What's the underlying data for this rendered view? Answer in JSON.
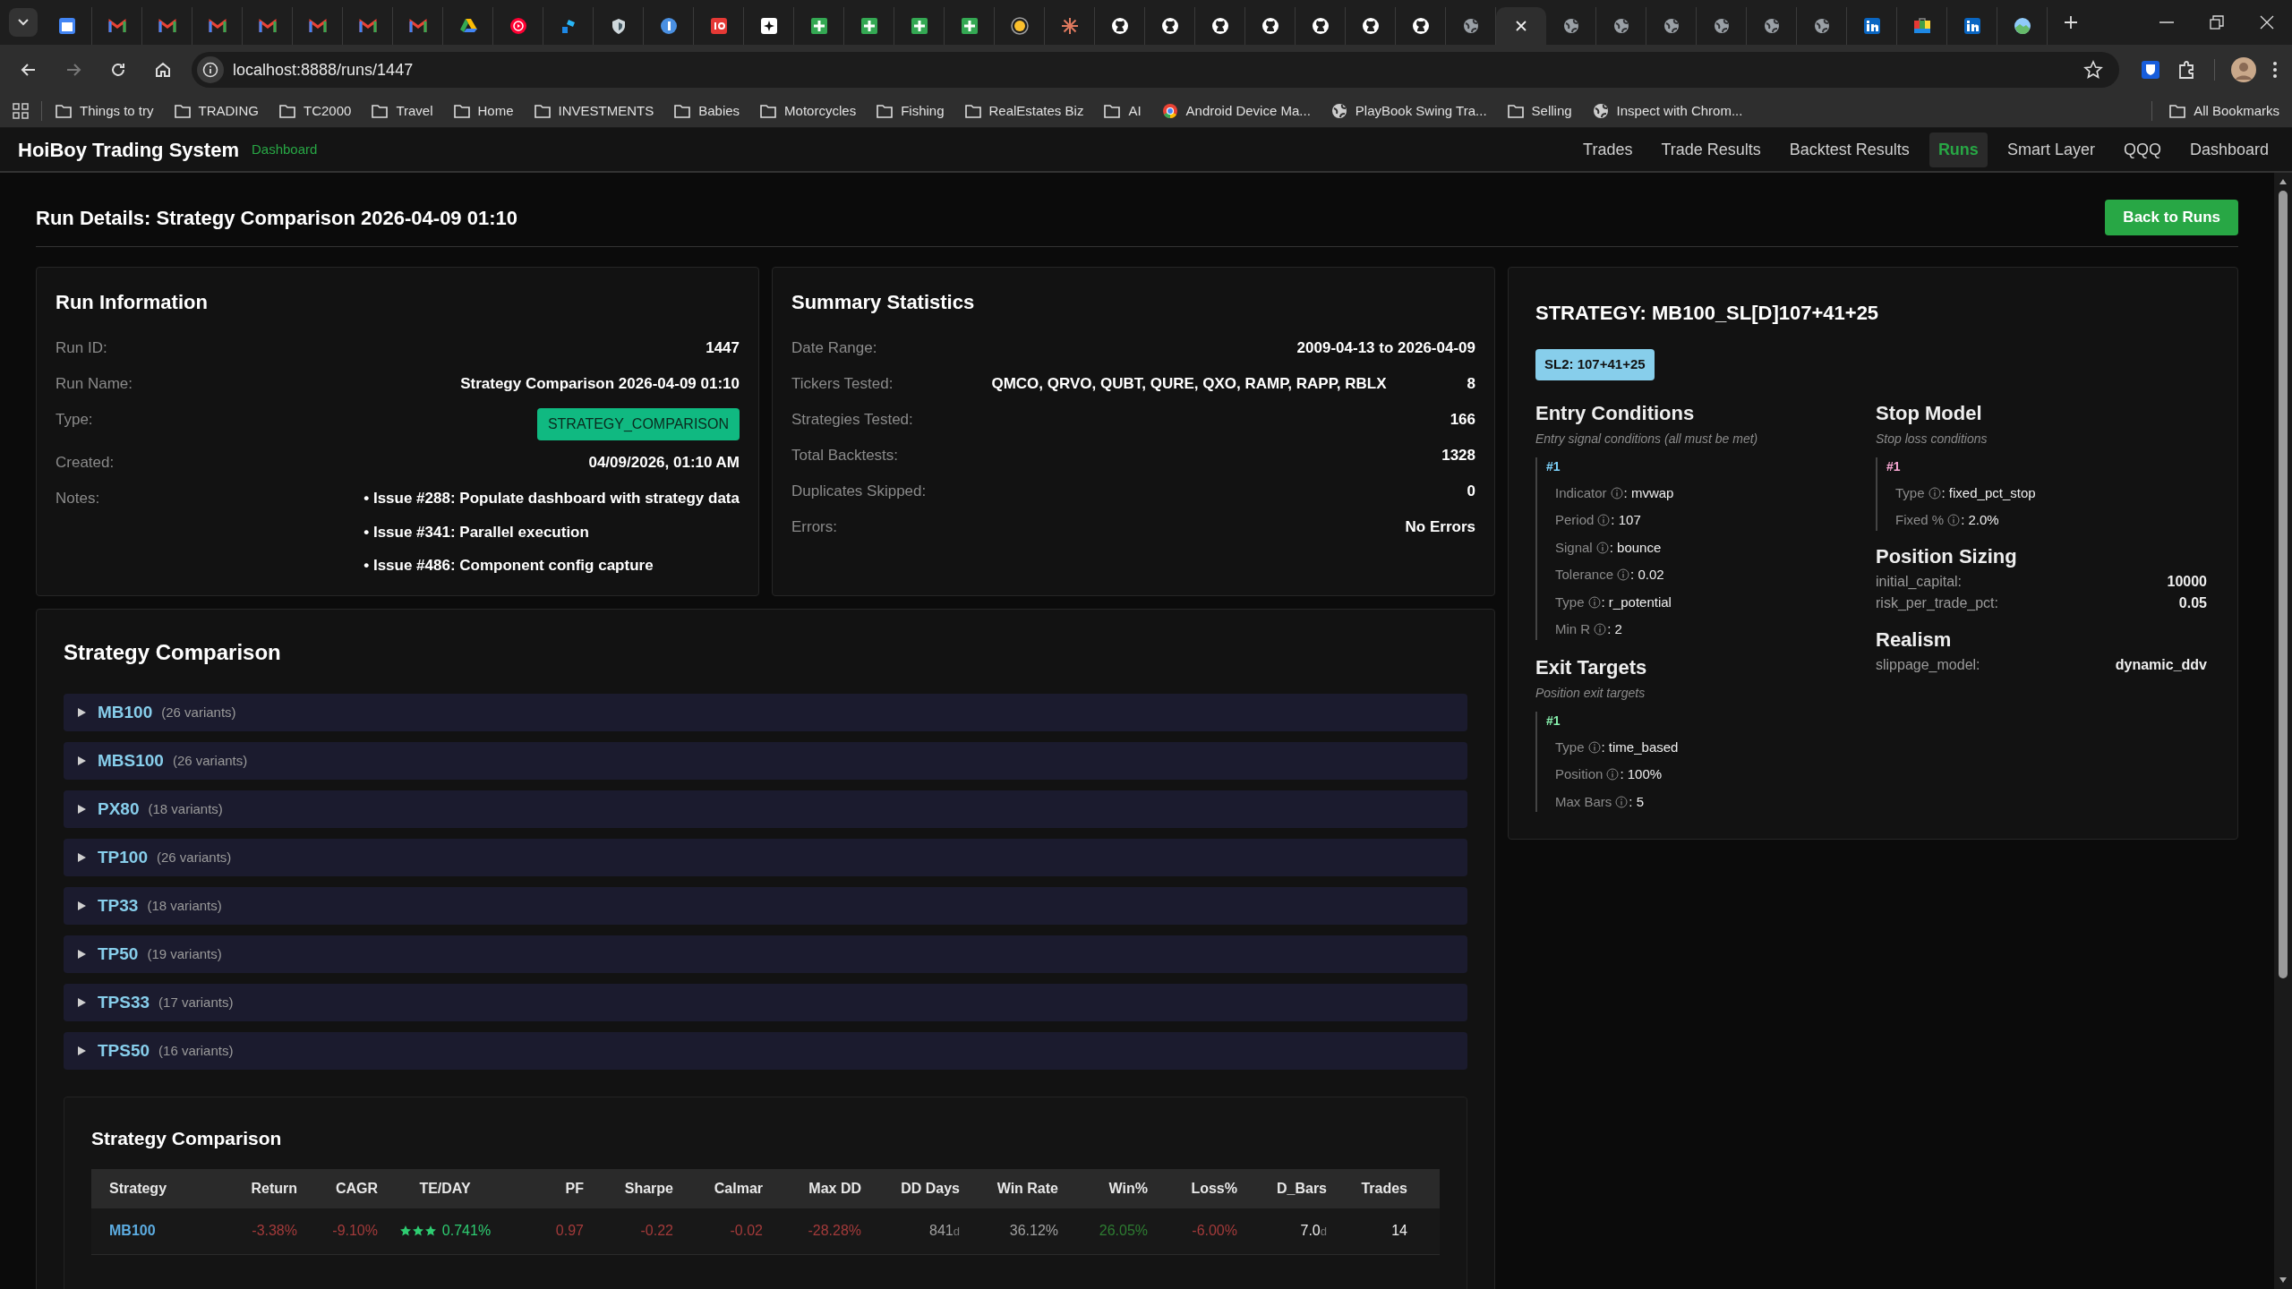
{
  "browser": {
    "tabs": [
      {
        "kind": "calendar",
        "selected": false
      },
      {
        "kind": "mail",
        "selected": false
      },
      {
        "kind": "mail",
        "selected": false
      },
      {
        "kind": "mail",
        "selected": false
      },
      {
        "kind": "mail",
        "selected": false
      },
      {
        "kind": "mail",
        "selected": false
      },
      {
        "kind": "mail",
        "selected": false
      },
      {
        "kind": "mail",
        "selected": false
      },
      {
        "kind": "drive",
        "selected": false
      },
      {
        "kind": "play",
        "selected": false
      },
      {
        "kind": "app",
        "selected": false
      },
      {
        "kind": "shield",
        "selected": false
      },
      {
        "kind": "disc",
        "selected": false
      },
      {
        "kind": "tile",
        "selected": false
      },
      {
        "kind": "sparkle",
        "selected": false
      },
      {
        "kind": "sheet",
        "selected": false
      },
      {
        "kind": "sheet",
        "selected": false
      },
      {
        "kind": "sheet",
        "selected": false
      },
      {
        "kind": "sheet",
        "selected": false
      },
      {
        "kind": "bulb",
        "selected": false
      },
      {
        "kind": "burst",
        "selected": false
      },
      {
        "kind": "octo",
        "selected": false
      },
      {
        "kind": "octo",
        "selected": false
      },
      {
        "kind": "octo",
        "selected": false
      },
      {
        "kind": "octo",
        "selected": false
      },
      {
        "kind": "octo",
        "selected": false
      },
      {
        "kind": "octo",
        "selected": false
      },
      {
        "kind": "octo",
        "selected": false
      },
      {
        "kind": "globe",
        "selected": false
      },
      {
        "kind": "close",
        "selected": true
      },
      {
        "kind": "globe",
        "selected": false
      },
      {
        "kind": "globe",
        "selected": false
      },
      {
        "kind": "globe",
        "selected": false
      },
      {
        "kind": "globe",
        "selected": false
      },
      {
        "kind": "globe",
        "selected": false
      },
      {
        "kind": "globe",
        "selected": false
      },
      {
        "kind": "network",
        "selected": false
      },
      {
        "kind": "bag",
        "selected": false
      },
      {
        "kind": "network",
        "selected": false
      },
      {
        "kind": "photo",
        "selected": false
      }
    ],
    "address": "localhost:8888/runs/1447",
    "bookmarks": [
      {
        "label": "Things to try",
        "kind": "folder"
      },
      {
        "label": "TRADING",
        "kind": "folder"
      },
      {
        "label": "TC2000",
        "kind": "folder"
      },
      {
        "label": "Travel",
        "kind": "folder"
      },
      {
        "label": "Home",
        "kind": "folder"
      },
      {
        "label": "INVESTMENTS",
        "kind": "folder"
      },
      {
        "label": "Babies",
        "kind": "folder"
      },
      {
        "label": "Motorcycles",
        "kind": "folder"
      },
      {
        "label": "Fishing",
        "kind": "folder"
      },
      {
        "label": "RealEstates Biz",
        "kind": "folder"
      },
      {
        "label": "AI",
        "kind": "folder"
      },
      {
        "label": "Android Device Ma...",
        "kind": "chrome"
      },
      {
        "label": "PlayBook Swing Tra...",
        "kind": "globe"
      },
      {
        "label": "Selling",
        "kind": "folder"
      },
      {
        "label": "Inspect with Chrom...",
        "kind": "globe"
      }
    ],
    "all_bookmarks": "All Bookmarks"
  },
  "app": {
    "title": "HoiBoy Trading System",
    "subtitle": "Dashboard",
    "nav": [
      {
        "label": "Trades",
        "selected": false
      },
      {
        "label": "Trade Results",
        "selected": false
      },
      {
        "label": "Backtest Results",
        "selected": false
      },
      {
        "label": "Runs",
        "selected": true
      },
      {
        "label": "Smart Layer",
        "selected": false
      },
      {
        "label": "QQQ",
        "selected": false
      },
      {
        "label": "Dashboard",
        "selected": false
      }
    ]
  },
  "page": {
    "title": "Run Details: Strategy Comparison 2026-04-09 01:10",
    "back_button": "Back to Runs"
  },
  "run_information": {
    "title": "Run Information",
    "rows": [
      {
        "kind": "text",
        "label": "Run ID:",
        "value": "1447"
      },
      {
        "kind": "text",
        "label": "Run Name:",
        "value": "Strategy Comparison 2026-04-09 01:10"
      },
      {
        "kind": "badge",
        "label": "Type:",
        "value": "STRATEGY_COMPARISON"
      },
      {
        "kind": "text",
        "label": "Created:",
        "value": "04/09/2026, 01:10 AM"
      },
      {
        "kind": "list",
        "label": "Notes:",
        "items": [
          "• Issue #288: Populate dashboard with strategy data",
          "• Issue #341: Parallel execution",
          "• Issue #486: Component config capture"
        ]
      }
    ]
  },
  "summary": {
    "title": "Summary Statistics",
    "rows": [
      {
        "label": "Date Range:",
        "value": "2009-04-13 to 2026-04-09"
      },
      {
        "label": "Tickers Tested:",
        "detail": "QMCO, QRVO, QUBT, QURE, QXO, RAMP, RAPP, RBLX",
        "value": "8"
      },
      {
        "label": "Strategies Tested:",
        "value": "166"
      },
      {
        "label": "Total Backtests:",
        "value": "1328"
      },
      {
        "label": "Duplicates Skipped:",
        "value": "0"
      },
      {
        "label": "Errors:",
        "value": "No Errors"
      }
    ]
  },
  "strategy": {
    "title": "STRATEGY: MB100_SL[D]107+41+25",
    "badge": "SL2: 107+41+25",
    "columns": [
      {
        "sections": [
          {
            "title": "Entry Conditions",
            "subtitle": "Entry signal conditions (all must be met)",
            "groups": [
              {
                "number": "#1",
                "color": "#7dd3fc",
                "params": [
                  {
                    "label": "Indicator",
                    "value": ": mvwap"
                  },
                  {
                    "label": "Period",
                    "value": ": 107"
                  },
                  {
                    "label": "Signal",
                    "value": ": bounce"
                  },
                  {
                    "label": "Tolerance",
                    "value": ": 0.02"
                  },
                  {
                    "label": "Type",
                    "value": ": r_potential"
                  },
                  {
                    "label": "Min R",
                    "value": ": 2"
                  }
                ]
              }
            ]
          },
          {
            "title": "Exit Targets",
            "subtitle": "Position exit targets",
            "groups": [
              {
                "number": "#1",
                "color": "#86efac",
                "params": [
                  {
                    "label": "Type",
                    "value": ": time_based"
                  },
                  {
                    "label": "Position",
                    "value": ": 100%"
                  },
                  {
                    "label": "Max Bars",
                    "value": ": 5"
                  }
                ]
              }
            ]
          }
        ]
      },
      {
        "sections": [
          {
            "title": "Stop Model",
            "subtitle": "Stop loss conditions",
            "groups": [
              {
                "number": "#1",
                "color": "#f9a8d4",
                "params": [
                  {
                    "label": "Type",
                    "value": ": fixed_pct_stop"
                  },
                  {
                    "label": "Fixed %",
                    "value": ": 2.0%"
                  }
                ]
              }
            ]
          },
          {
            "title": "Position Sizing",
            "settings": [
              {
                "label": "initial_capital:",
                "value": "10000"
              },
              {
                "label": "risk_per_trade_pct:",
                "value": "0.05"
              }
            ]
          },
          {
            "title": "Realism",
            "settings": [
              {
                "label": "slippage_model:",
                "value": "dynamic_ddv"
              }
            ]
          }
        ]
      }
    ]
  },
  "comparison": {
    "title": "Strategy Comparison",
    "groups": [
      {
        "name": "MB100",
        "count": "(26 variants)",
        "expanded": false
      },
      {
        "name": "MBS100",
        "count": "(26 variants)",
        "expanded": false
      },
      {
        "name": "PX80",
        "count": "(18 variants)",
        "expanded": false
      },
      {
        "name": "TP100",
        "count": "(26 variants)",
        "expanded": false
      },
      {
        "name": "TP33",
        "count": "(18 variants)",
        "expanded": false
      },
      {
        "name": "TP50",
        "count": "(19 variants)",
        "expanded": false
      },
      {
        "name": "TPS33",
        "count": "(17 variants)",
        "expanded": false
      },
      {
        "name": "TPS50",
        "count": "(16 variants)",
        "expanded": false
      }
    ],
    "table": {
      "title": "Strategy Comparison",
      "columns": [
        "Strategy",
        "Return",
        "CAGR",
        "TE/DAY",
        "PF",
        "Sharpe",
        "Calmar",
        "Max DD",
        "DD Days",
        "Win Rate",
        "Win%",
        "Loss%",
        "D_Bars",
        "Trades"
      ],
      "rows": [
        {
          "cells": [
            {
              "kind": "link",
              "text": "MB100"
            },
            {
              "kind": "negative",
              "text": "-3.38%"
            },
            {
              "kind": "negative",
              "text": "-9.10%"
            },
            {
              "kind": "rating",
              "stars": 3,
              "text": "0.741%"
            },
            {
              "kind": "negative",
              "text": "0.97"
            },
            {
              "kind": "negative",
              "text": "-0.22"
            },
            {
              "kind": "negative",
              "text": "-0.02"
            },
            {
              "kind": "negative",
              "text": "-28.28%"
            },
            {
              "kind": "muted",
              "text": "841",
              "unit": "d"
            },
            {
              "kind": "muted",
              "text": "36.12%"
            },
            {
              "kind": "positive",
              "text": "26.05%"
            },
            {
              "kind": "negative",
              "text": "-6.00%"
            },
            {
              "kind": "plain",
              "text": "7.0",
              "unit": "d"
            },
            {
              "kind": "plain",
              "text": "14"
            }
          ]
        }
      ]
    }
  }
}
